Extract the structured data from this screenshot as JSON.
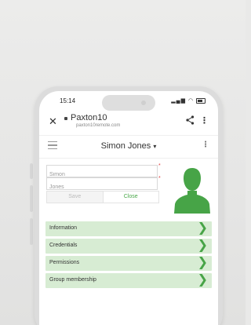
{
  "status_bar": {
    "time": "15:14",
    "icons": "signal-wifi-battery"
  },
  "browser": {
    "site_title": "Paxton10",
    "domain": "paxton10remote.com",
    "close_icon": "close-icon",
    "share_icon": "share-icon",
    "more_icon": "more-vertical-icon"
  },
  "app_header": {
    "user_name": "Simon Jones",
    "caret": "▾",
    "menu_icon": "hamburger-icon",
    "options_icon": "kebab-icon"
  },
  "user_form": {
    "first_name": "Simon",
    "last_name": "Jones",
    "required_marker": "*",
    "save_label": "Save",
    "close_label": "Close"
  },
  "sections": [
    {
      "label": "Information"
    },
    {
      "label": "Credentials"
    },
    {
      "label": "Permissions"
    },
    {
      "label": "Group membership"
    }
  ],
  "colors": {
    "accent_green": "#47a447",
    "row_background": "#d7ecd3",
    "required_red": "#e04040"
  }
}
